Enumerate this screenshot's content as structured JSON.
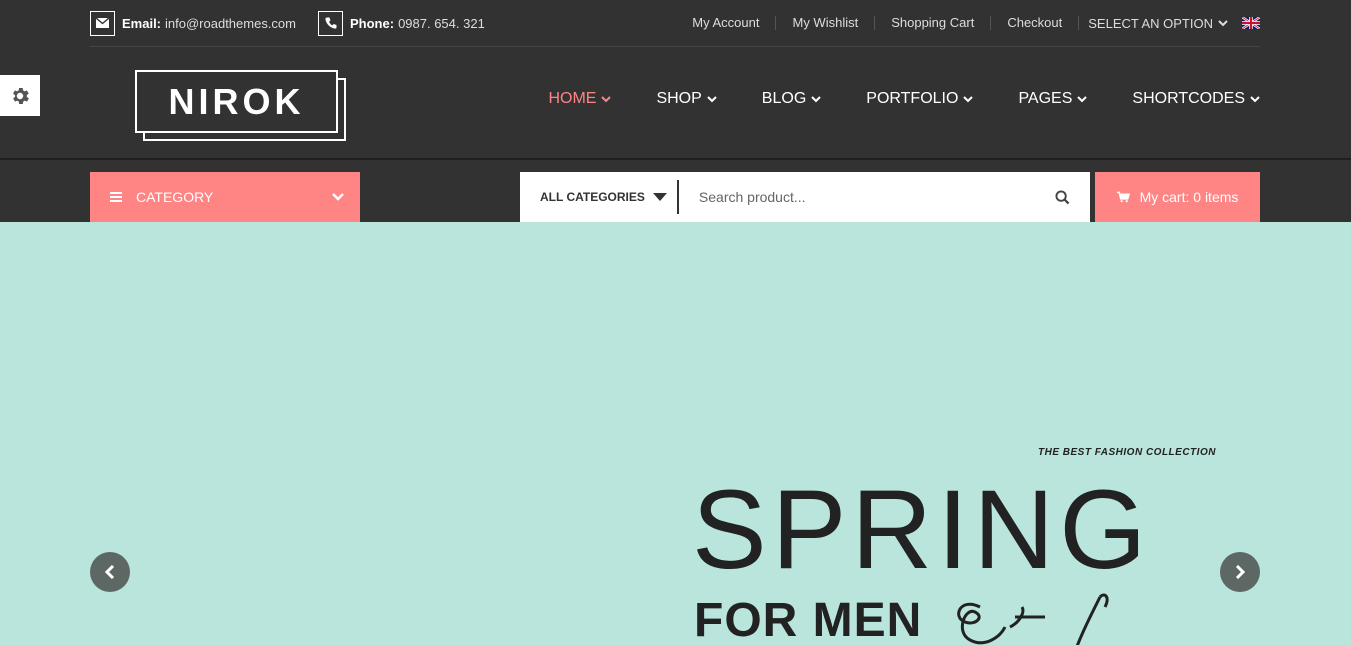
{
  "topbar": {
    "email_label": "Email:",
    "email_value": "info@roadthemes.com",
    "phone_label": "Phone:",
    "phone_value": "0987. 654. 321",
    "links": [
      "My Account",
      "My Wishlist",
      "Shopping Cart",
      "Checkout"
    ],
    "select_option": "SELECT AN OPTION",
    "flag_icon": "uk-flag-icon"
  },
  "logo": {
    "text": "NIROK"
  },
  "nav": {
    "items": [
      {
        "label": "HOME",
        "active": true
      },
      {
        "label": "SHOP",
        "active": false
      },
      {
        "label": "BLOG",
        "active": false
      },
      {
        "label": "PORTFOLIO",
        "active": false
      },
      {
        "label": "PAGES",
        "active": false
      },
      {
        "label": "SHORTCODES",
        "active": false
      }
    ]
  },
  "category": {
    "label": "CATEGORY"
  },
  "search": {
    "category_label": "ALL CATEGORIES",
    "placeholder": "Search product..."
  },
  "cart": {
    "label": "My cart: 0 items"
  },
  "hero": {
    "tagline": "THE BEST FASHION COLLECTION",
    "headline": "SPRING",
    "subheadline": "FOR MEN"
  },
  "colors": {
    "dark_bg": "#323232",
    "accent": "#ff8484",
    "hero_bg": "#bae5dc",
    "arrow_bg": "#5d6865"
  }
}
